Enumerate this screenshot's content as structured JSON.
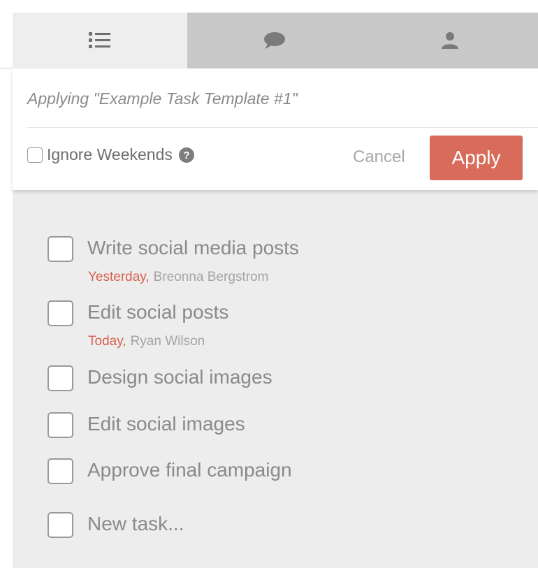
{
  "tabs": [
    {
      "name": "list-icon",
      "active": true
    },
    {
      "name": "comment-icon",
      "active": false
    },
    {
      "name": "person-icon",
      "active": false
    }
  ],
  "template": {
    "applying_text": "Applying \"Example Task Template #1\"",
    "ignore_weekends_label": "Ignore Weekends",
    "help_icon": "question-icon",
    "cancel_label": "Cancel",
    "apply_label": "Apply"
  },
  "tasks": [
    {
      "title": "Write social media posts",
      "due": "Yesterday,",
      "assignee": "Breonna Bergstrom"
    },
    {
      "title": "Edit social posts",
      "due": "Today,",
      "assignee": "Ryan Wilson"
    },
    {
      "title": "Design social images"
    },
    {
      "title": "Edit social images"
    },
    {
      "title": "Approve final campaign"
    },
    {
      "title": "New task..."
    }
  ],
  "colors": {
    "accent": "#d86b5a",
    "due_text": "#d7604d",
    "panel_bg": "#ededed",
    "tab_bg": "#c8c8c8"
  }
}
